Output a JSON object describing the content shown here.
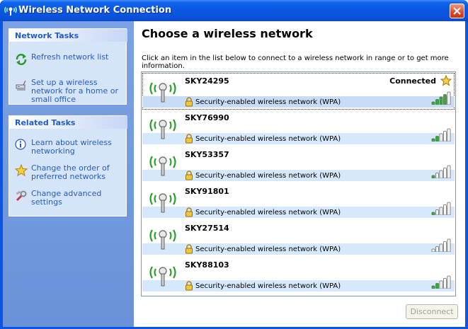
{
  "window": {
    "title": "Wireless Network Connection"
  },
  "sidebar": {
    "network_tasks": {
      "header": "Network Tasks",
      "items": [
        {
          "label": "Refresh network list",
          "icon": "refresh-icon"
        },
        {
          "label": "Set up a wireless network for a home or small office",
          "icon": "setup-network-icon"
        }
      ]
    },
    "related_tasks": {
      "header": "Related Tasks",
      "items": [
        {
          "label": "Learn about wireless networking",
          "icon": "info-icon"
        },
        {
          "label": "Change the order of preferred networks",
          "icon": "star-icon"
        },
        {
          "label": "Change advanced settings",
          "icon": "settings-icon"
        }
      ]
    }
  },
  "main": {
    "heading": "Choose a wireless network",
    "instructions": "Click an item in the list below to connect to a wireless network in range or to get more information."
  },
  "networks": [
    {
      "ssid": "SKY24295",
      "security": "Security-enabled wireless network (WPA)",
      "status": "Connected",
      "signal_bars": 4,
      "selected": true
    },
    {
      "ssid": "SKY76990",
      "security": "Security-enabled wireless network (WPA)",
      "status": "",
      "signal_bars": 2,
      "selected": false
    },
    {
      "ssid": "SKY53357",
      "security": "Security-enabled wireless network (WPA)",
      "status": "",
      "signal_bars": 1,
      "selected": false
    },
    {
      "ssid": "SKY91801",
      "security": "Security-enabled wireless network (WPA)",
      "status": "",
      "signal_bars": 1,
      "selected": false
    },
    {
      "ssid": "SKY27514",
      "security": "Security-enabled wireless network (WPA)",
      "status": "",
      "signal_bars": 0,
      "selected": false
    },
    {
      "ssid": "SKY88103",
      "security": "Security-enabled wireless network (WPA)",
      "status": "",
      "signal_bars": 2,
      "selected": false
    }
  ],
  "buttons": {
    "disconnect": "Disconnect"
  },
  "colors": {
    "title_bar": "#0a55e4",
    "sidebar": "#6a92d8",
    "link": "#215dc6",
    "signal_active": "#2bb32b",
    "signal_inactive": "#ffffff"
  }
}
